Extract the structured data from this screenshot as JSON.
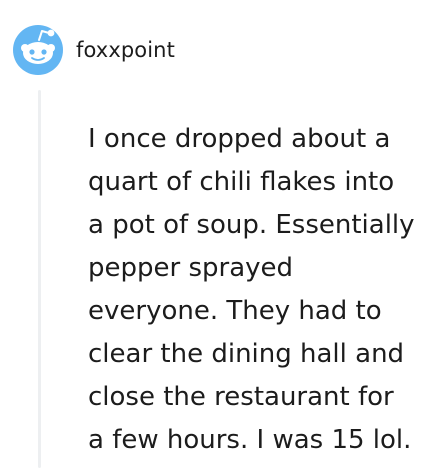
{
  "comment": {
    "author": "foxxpoint",
    "avatar_icon": "reddit-snoo-avatar-icon",
    "body": "I once dropped about a\nquart of chili flakes into\na pot of soup. Essentially\npepper sprayed\neveryone. They had to\nclear the dining hall and\nclose the restaurant for\na few hours. I was 15 lol."
  },
  "colors": {
    "avatar_bg": "#63b6f3",
    "text": "#1c1c1c",
    "thread_line": "#edeff1"
  }
}
